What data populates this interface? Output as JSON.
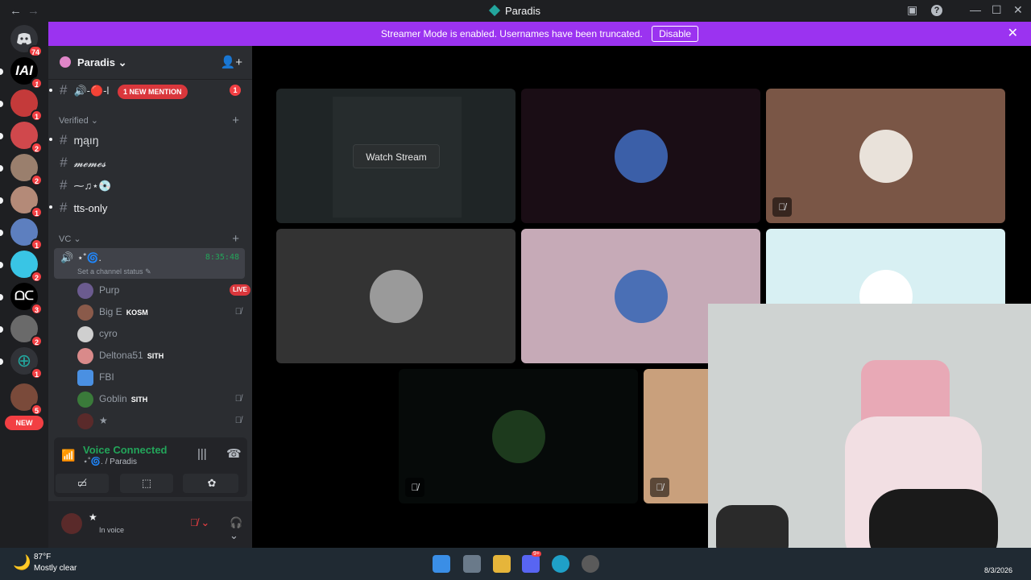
{
  "window": {
    "title": "Paradis"
  },
  "banner": {
    "text": "Streamer Mode is enabled. Usernames have been truncated.",
    "button": "Disable"
  },
  "guilds": {
    "home_badge": "74",
    "badges": [
      "1",
      "1",
      "2",
      "2",
      "1",
      "1",
      "2",
      "3",
      "2",
      "1",
      "5"
    ],
    "new_label": "NEW"
  },
  "server": {
    "name": "Paradis"
  },
  "channels": {
    "top": {
      "name": "🔊-🔴-l",
      "mention": "1 NEW MENTION",
      "badge": "1"
    },
    "categories": [
      {
        "name": "Verified",
        "channels": [
          "ɱąıŋ",
          "𝓶𝓮𝓶𝓮𝓼",
          "⁓♫⋆💿",
          "tts-only"
        ]
      },
      {
        "name": "VC"
      }
    ],
    "voice": {
      "name": "⋆˚🌀.",
      "timer": "8:35:48",
      "status": "Set a channel status"
    }
  },
  "members": [
    {
      "name": "Purp",
      "live": "LIVE"
    },
    {
      "name": "Big E",
      "tag": "KOSM"
    },
    {
      "name": "cyro"
    },
    {
      "name": "Deltona51",
      "tag": "SITH"
    },
    {
      "name": "FBI"
    },
    {
      "name": "Goblin",
      "tag": "SITH"
    },
    {
      "name": "★"
    }
  ],
  "voice_panel": {
    "status": "Voice Connected",
    "location": "⋆˚🌀. / Paradis"
  },
  "user_panel": {
    "name": "★",
    "status": "In voice"
  },
  "stage": {
    "watch_label": "Watch Stream"
  },
  "taskbar": {
    "temp": "87°F",
    "weather": "Mostly clear",
    "date": "8/3/2026",
    "discord_badge": "9+"
  },
  "colors": {
    "accent": "#9b33f0",
    "online": "#23a55a",
    "danger": "#f23f43"
  }
}
